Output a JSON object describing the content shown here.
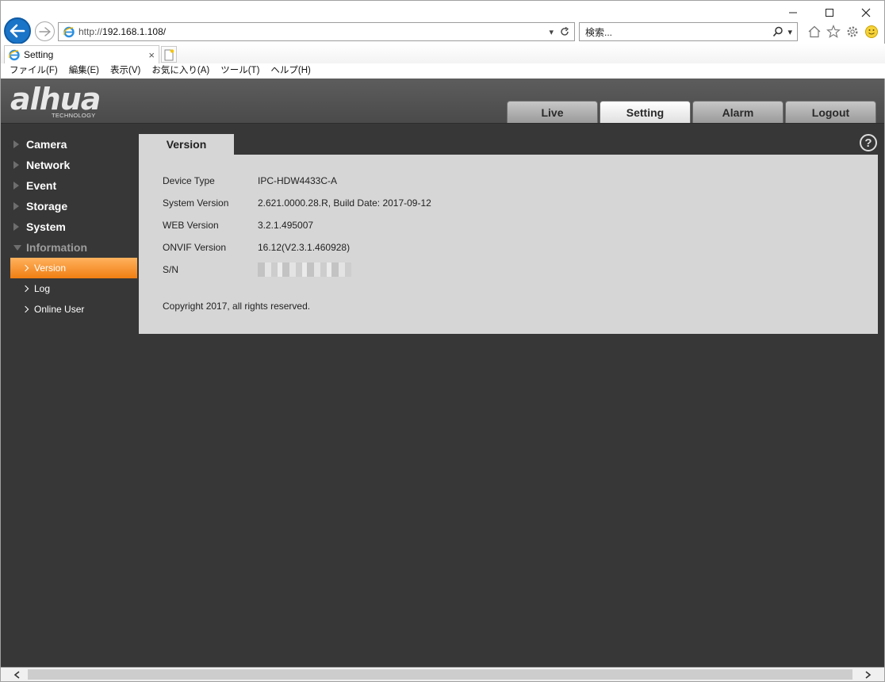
{
  "browser": {
    "url_scheme": "http://",
    "url_host": "192.168.1.108/",
    "search_placeholder": "検索...",
    "tab_title": "Setting",
    "tab_close": "×",
    "menu": [
      "ファイル(F)",
      "編集(E)",
      "表示(V)",
      "お気に入り(A)",
      "ツール(T)",
      "ヘルプ(H)"
    ]
  },
  "app": {
    "logo_text": "alhua",
    "logo_sub": "TECHNOLOGY",
    "main_tabs": [
      "Live",
      "Setting",
      "Alarm",
      "Logout"
    ],
    "active_main_tab": "Setting",
    "sidebar": {
      "items": [
        "Camera",
        "Network",
        "Event",
        "Storage",
        "System",
        "Information"
      ],
      "sub_items": [
        "Version",
        "Log",
        "Online User"
      ]
    },
    "content_tab": "Version",
    "help": "?",
    "version_info": {
      "device_type_label": "Device Type",
      "device_type": "IPC-HDW4433C-A",
      "system_version_label": "System Version",
      "system_version": "2.621.0000.28.R, Build Date: 2017-09-12",
      "web_version_label": "WEB Version",
      "web_version": "3.2.1.495007",
      "onvif_version_label": "ONVIF Version",
      "onvif_version": "16.12(V2.3.1.460928)",
      "sn_label": "S/N"
    },
    "copyright": "Copyright 2017, all rights reserved."
  },
  "colors": {
    "app_bg": "#373737",
    "header_bg": "#555555",
    "panel_bg": "#d6d6d6",
    "active_orange": "#f07e12",
    "ie_blue": "#1a74c8"
  }
}
